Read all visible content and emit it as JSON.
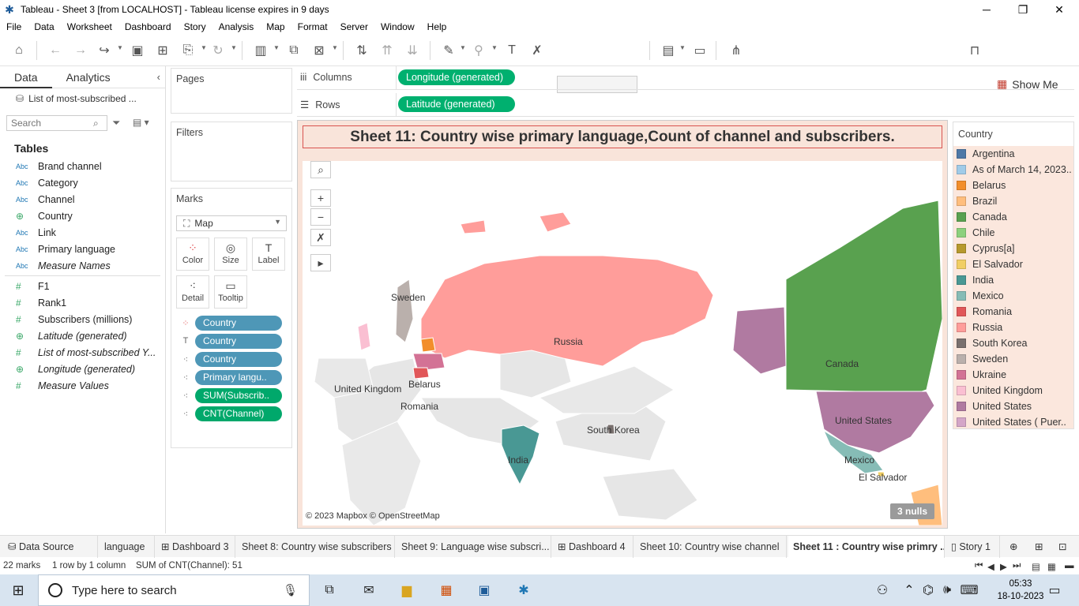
{
  "window": {
    "title": "Tableau - Sheet 3 [from LOCALHOST] - Tableau license expires in 9 days",
    "minimize": "─",
    "maximize": "❐",
    "close": "✕"
  },
  "menu": [
    "File",
    "Data",
    "Worksheet",
    "Dashboard",
    "Story",
    "Analysis",
    "Map",
    "Format",
    "Server",
    "Window",
    "Help"
  ],
  "toolbar": {
    "show_me_label": "Show Me"
  },
  "left_pane": {
    "tabs": [
      "Data",
      "Analytics"
    ],
    "datasource": "List of most-subscribed ...",
    "search_placeholder": "Search",
    "tables_heading": "Tables",
    "dimensions": [
      {
        "type": "Abc",
        "name": "Brand channel"
      },
      {
        "type": "Abc",
        "name": "Category"
      },
      {
        "type": "Abc",
        "name": "Channel"
      },
      {
        "type": "globe",
        "name": "Country"
      },
      {
        "type": "Abc",
        "name": "Link"
      },
      {
        "type": "Abc",
        "name": "Primary language"
      },
      {
        "type": "Abc",
        "name": "Measure Names"
      }
    ],
    "measures": [
      {
        "type": "#",
        "name": "F1"
      },
      {
        "type": "#",
        "name": "Rank1"
      },
      {
        "type": "#",
        "name": "Subscribers (millions)"
      },
      {
        "type": "globe",
        "name": "Latitude (generated)"
      },
      {
        "type": "#",
        "name": "List of most-subscribed Y..."
      },
      {
        "type": "globe",
        "name": "Longitude (generated)"
      },
      {
        "type": "#",
        "name": "Measure Values"
      }
    ]
  },
  "cards": {
    "pages": "Pages",
    "filters": "Filters",
    "marks": "Marks",
    "mark_type": "Map",
    "buttons": [
      "Color",
      "Size",
      "Label",
      "Detail",
      "Tooltip"
    ],
    "pills": [
      "Country",
      "Country",
      "Country",
      "Primary langu..",
      "SUM(Subscrib..",
      "CNT(Channel)"
    ]
  },
  "shelves": {
    "columns_label": "Columns",
    "columns_pill": "Longitude (generated)",
    "rows_label": "Rows",
    "rows_pill": "Latitude (generated)"
  },
  "viz": {
    "title": "Sheet 11: Country wise primary language,Count of channel and subscribers.",
    "credit": "© 2023 Mapbox © OpenStreetMap",
    "nulls": "3 nulls",
    "labels": [
      "Sweden",
      "Russia",
      "United Kingdom",
      "Belarus",
      "Romania",
      "South Korea",
      "India",
      "Canada",
      "United States",
      "Mexico",
      "El Salvador"
    ]
  },
  "legend": {
    "title": "Country",
    "items": [
      {
        "label": "Argentina",
        "color": "#4e79a7"
      },
      {
        "label": "As of March 14, 2023..",
        "color": "#a0cbe8"
      },
      {
        "label": "Belarus",
        "color": "#f28e2b"
      },
      {
        "label": "Brazil",
        "color": "#ffbe7d"
      },
      {
        "label": "Canada",
        "color": "#59a14f"
      },
      {
        "label": "Chile",
        "color": "#8cd17d"
      },
      {
        "label": "Cyprus[a]",
        "color": "#b6992d"
      },
      {
        "label": "El Salvador",
        "color": "#f1ce63"
      },
      {
        "label": "India",
        "color": "#499894"
      },
      {
        "label": "Mexico",
        "color": "#86bcb6"
      },
      {
        "label": "Romania",
        "color": "#e15759"
      },
      {
        "label": "Russia",
        "color": "#ff9d9a"
      },
      {
        "label": "South Korea",
        "color": "#79706e"
      },
      {
        "label": "Sweden",
        "color": "#bab0ac"
      },
      {
        "label": "Ukraine",
        "color": "#d37295"
      },
      {
        "label": "United Kingdom",
        "color": "#fabfd2"
      },
      {
        "label": "United States",
        "color": "#b07aa1"
      },
      {
        "label": "United States ( Puer..",
        "color": "#d4a6c8"
      }
    ]
  },
  "sheet_tabs": [
    "Data Source",
    "language",
    "Dashboard 3",
    "Sheet 8: Country wise subscribers",
    "Sheet 9: Language wise subscri...",
    "Dashboard 4",
    "Sheet 10: Country wise channel",
    "Sheet 11 : Country wise primry ...",
    "Story 1"
  ],
  "status": {
    "marks": "22 marks",
    "rows_cols": "1 row by 1 column",
    "sum": "SUM of CNT(Channel): 51"
  },
  "taskbar": {
    "search_placeholder": "Type here to search",
    "time": "05:33",
    "date": "18-10-2023"
  }
}
